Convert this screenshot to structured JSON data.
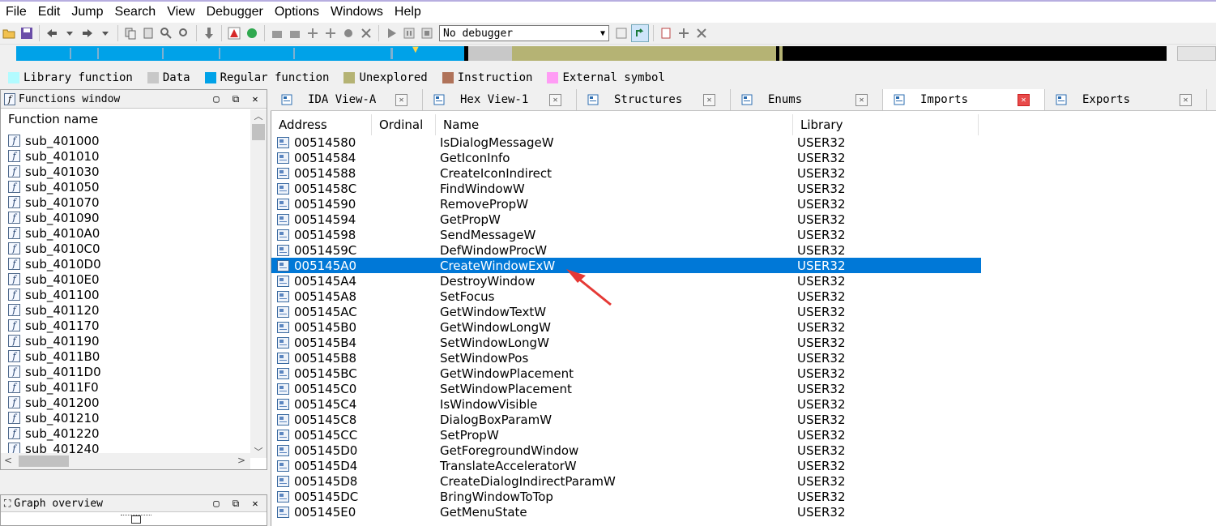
{
  "menu": [
    "File",
    "Edit",
    "Jump",
    "Search",
    "View",
    "Debugger",
    "Options",
    "Windows",
    "Help"
  ],
  "toolbar": {
    "debugger_select": "No debugger",
    "icons": [
      "open-icon",
      "save-icon",
      "back-icon",
      "forward-icon",
      "copy-icon",
      "paste-icon",
      "find-icon",
      "down-arrow-icon",
      "search-icon",
      "stop-icon",
      "go-icon",
      "hex-icon",
      "struct-icon",
      "play-icon",
      "pause-icon",
      "stop-square-icon",
      "settings-icon"
    ]
  },
  "colors": {
    "library": "#b2fbff",
    "data": "#c8c8c8",
    "regular": "#00a2e8",
    "unexplored": "#b5b374",
    "instruction": "#b0735a",
    "external": "#ff9cf5",
    "selection": "#0078d7"
  },
  "legend": [
    {
      "label": "Library function",
      "color": "#b2fbff"
    },
    {
      "label": "Data",
      "color": "#c8c8c8"
    },
    {
      "label": "Regular function",
      "color": "#00a2e8"
    },
    {
      "label": "Unexplored",
      "color": "#b5b374"
    },
    {
      "label": "Instruction",
      "color": "#b0735a"
    },
    {
      "label": "External symbol",
      "color": "#ff9cf5"
    }
  ],
  "functions_window": {
    "title": "Functions window",
    "column": "Function name",
    "items": [
      "sub_401000",
      "sub_401010",
      "sub_401030",
      "sub_401050",
      "sub_401070",
      "sub_401090",
      "sub_4010A0",
      "sub_4010C0",
      "sub_4010D0",
      "sub_4010E0",
      "sub_401100",
      "sub_401120",
      "sub_401170",
      "sub_401190",
      "sub_4011B0",
      "sub_4011D0",
      "sub_4011F0",
      "sub_401200",
      "sub_401210",
      "sub_401220",
      "sub_401240"
    ]
  },
  "graph_overview": {
    "title": "Graph overview"
  },
  "tabs": [
    {
      "label": "IDA View-A",
      "icon": "ida-view-icon"
    },
    {
      "label": "Hex View-1",
      "icon": "hex-view-icon"
    },
    {
      "label": "Structures",
      "icon": "structures-icon"
    },
    {
      "label": "Enums",
      "icon": "enums-icon"
    },
    {
      "label": "Imports",
      "icon": "imports-icon",
      "active": true
    },
    {
      "label": "Exports",
      "icon": "exports-icon"
    }
  ],
  "imports": {
    "columns": {
      "address": "Address",
      "ordinal": "Ordinal",
      "name": "Name",
      "library": "Library"
    },
    "rows": [
      {
        "address": "00514580",
        "name": "IsDialogMessageW",
        "library": "USER32"
      },
      {
        "address": "00514584",
        "name": "GetIconInfo",
        "library": "USER32"
      },
      {
        "address": "00514588",
        "name": "CreateIconIndirect",
        "library": "USER32"
      },
      {
        "address": "0051458C",
        "name": "FindWindowW",
        "library": "USER32"
      },
      {
        "address": "00514590",
        "name": "RemovePropW",
        "library": "USER32"
      },
      {
        "address": "00514594",
        "name": "GetPropW",
        "library": "USER32"
      },
      {
        "address": "00514598",
        "name": "SendMessageW",
        "library": "USER32"
      },
      {
        "address": "0051459C",
        "name": "DefWindowProcW",
        "library": "USER32"
      },
      {
        "address": "005145A0",
        "name": "CreateWindowExW",
        "library": "USER32",
        "selected": true
      },
      {
        "address": "005145A4",
        "name": "DestroyWindow",
        "library": "USER32"
      },
      {
        "address": "005145A8",
        "name": "SetFocus",
        "library": "USER32"
      },
      {
        "address": "005145AC",
        "name": "GetWindowTextW",
        "library": "USER32"
      },
      {
        "address": "005145B0",
        "name": "GetWindowLongW",
        "library": "USER32"
      },
      {
        "address": "005145B4",
        "name": "SetWindowLongW",
        "library": "USER32"
      },
      {
        "address": "005145B8",
        "name": "SetWindowPos",
        "library": "USER32"
      },
      {
        "address": "005145BC",
        "name": "GetWindowPlacement",
        "library": "USER32"
      },
      {
        "address": "005145C0",
        "name": "SetWindowPlacement",
        "library": "USER32"
      },
      {
        "address": "005145C4",
        "name": "IsWindowVisible",
        "library": "USER32"
      },
      {
        "address": "005145C8",
        "name": "DialogBoxParamW",
        "library": "USER32"
      },
      {
        "address": "005145CC",
        "name": "SetPropW",
        "library": "USER32"
      },
      {
        "address": "005145D0",
        "name": "GetForegroundWindow",
        "library": "USER32"
      },
      {
        "address": "005145D4",
        "name": "TranslateAcceleratorW",
        "library": "USER32"
      },
      {
        "address": "005145D8",
        "name": "CreateDialogIndirectParamW",
        "library": "USER32"
      },
      {
        "address": "005145DC",
        "name": "BringWindowToTop",
        "library": "USER32"
      },
      {
        "address": "005145E0",
        "name": "GetMenuState",
        "library": "USER32"
      }
    ]
  },
  "annotation": {
    "color": "#e53935",
    "target": "CreateWindowExW"
  }
}
